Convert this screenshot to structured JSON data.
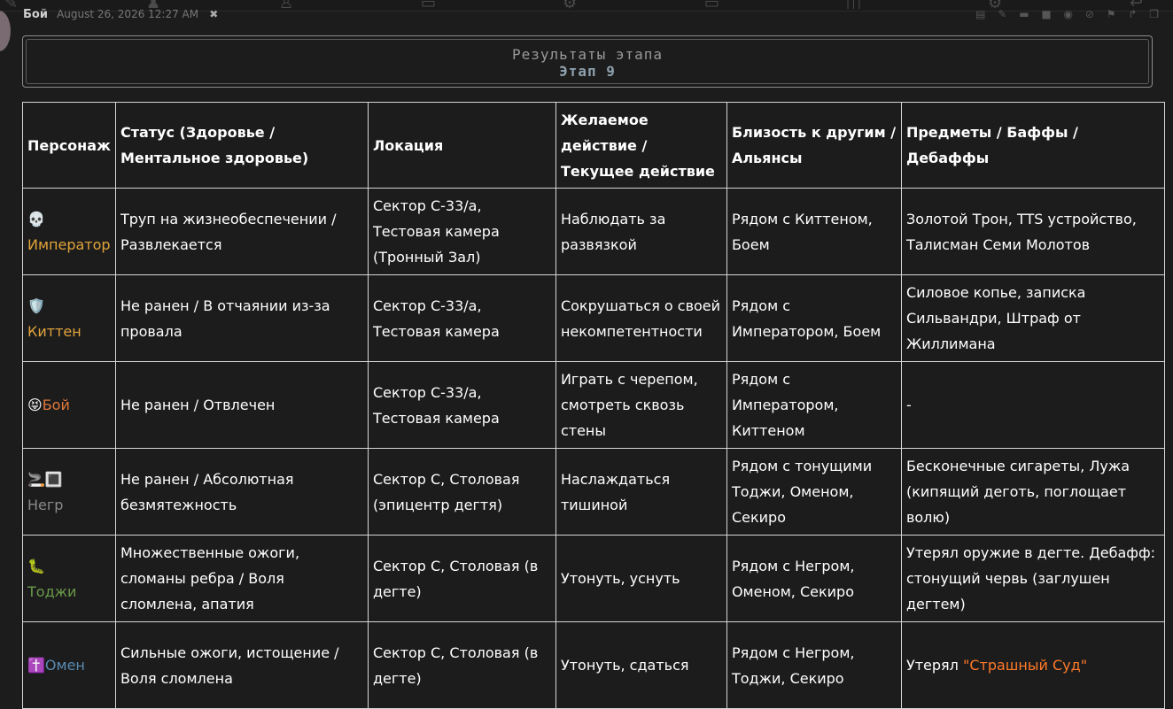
{
  "post": {
    "author": "Бой",
    "date": "August 26, 2026 12:27 AM"
  },
  "icons": {
    "pin": "wrench-icon",
    "toolbar": [
      "edit-icon",
      "user-icon",
      "archive-icon",
      "gear-icon",
      "box-icon",
      "map-icon"
    ],
    "actions": [
      "embed-icon",
      "pencil-icon",
      "comment-icon",
      "save-icon",
      "eye-icon",
      "link-icon",
      "flag-icon",
      "reply-icon",
      "copy-icon"
    ]
  },
  "stage": {
    "title": "Результаты этапа",
    "subtitle": "Этап 9"
  },
  "table": {
    "headers": [
      "Персонаж",
      "Статус (Здоровье / Ментальное здоровье)",
      "Локация",
      "Желаемое действие / Текущее действие",
      "Близость к другим / Альянсы",
      "Предметы / Баффы / Дебаффы"
    ],
    "rows": [
      {
        "emoji": "💀",
        "name": "Император",
        "color": "#e1a43b",
        "status": "Труп на жизнеобеспечении / Развлекается",
        "location": "Сектор С-33/а, Тестовая камера (Тронный Зал)",
        "action": "Наблюдать за развязкой",
        "proximity": "Рядом с Киттеном, Боем",
        "items": "Золотой Трон, TTS устройство, Талисман Семи Молотов"
      },
      {
        "emoji": "🛡️",
        "name": "Киттен",
        "color": "#e1a43b",
        "status": "Не ранен / В отчаянии из-за провала",
        "location": "Сектор С-33/а, Тестовая камера",
        "action": "Сокрушаться о своей некомпетентности",
        "proximity": "Рядом с Императором, Боем",
        "items": "Силовое копье, записка Сильвандри, Штраф от Жиллимана"
      },
      {
        "emoji": "😝",
        "name": "Бой",
        "color": "#e0783a",
        "status": "Не ранен / Отвлечен",
        "location": "Сектор С-33/а, Тестовая камера",
        "action": "Играть с черепом, смотреть сквозь стены",
        "proximity": "Рядом с Императором, Киттеном",
        "items": "-"
      },
      {
        "emoji": "🚬🔳",
        "name": "Негр",
        "color": "#8a8a8a",
        "status": "Не ранен / Абсолютная безмятежность",
        "location": "Сектор С, Столовая (эпицентр дегтя)",
        "action": "Наслаждаться тишиной",
        "proximity": "Рядом с тонущими Тоджи, Оменом, Секиро",
        "items": "Бесконечные сигареты, Лужа (кипящий деготь, поглощает волю)"
      },
      {
        "emoji": "🐛",
        "name": "Тоджи",
        "color": "#6a9a4a",
        "status": "Множественные ожоги, сломаны ребра / Воля сломлена, апатия",
        "location": "Сектор С, Столовая (в дегте)",
        "action": "Утонуть, уснуть",
        "proximity": "Рядом с Негром, Оменом, Секиро",
        "items": "Утерял оружие в дегте. Дебафф: стонущий червь (заглушен дегтем)"
      },
      {
        "emoji": "✝️",
        "name": "Омен",
        "color": "#5a8ab0",
        "status": "Сильные ожоги, истощение / Воля сломлена",
        "location": "Сектор С, Столовая (в дегте)",
        "action": "Утонуть, сдаться",
        "proximity": "Рядом с Негром, Тоджи, Секиро",
        "items_prefix": "Утерял ",
        "items_highlight": "\"Страшный Суд\"",
        "items_highlight_color": "#ff7a2a"
      }
    ]
  }
}
